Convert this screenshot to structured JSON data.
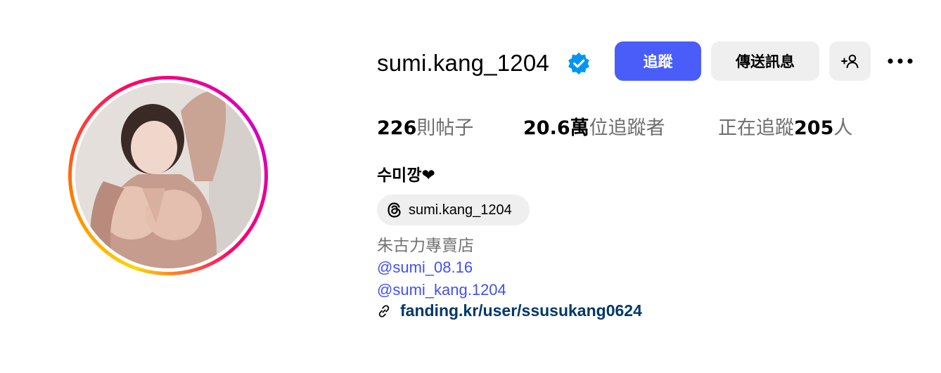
{
  "profile": {
    "username": "sumi.kang_1204",
    "full_name": "수미깡❤",
    "verified": true,
    "avatar_ring_colors": [
      "#ffd600",
      "#ff7a00",
      "#ff0169",
      "#d300c5"
    ]
  },
  "actions": {
    "follow_label": "追蹤",
    "message_label": "傳送訊息",
    "follow_color": "#4a5df9"
  },
  "stats": {
    "posts_count": "226",
    "posts_label": "則帖子",
    "followers_count": "20.6萬",
    "followers_label": "位追蹤者",
    "following_prefix": "正在追蹤",
    "following_count": "205",
    "following_suffix": "人"
  },
  "threads": {
    "handle": "sumi.kang_1204",
    "icon": "threads-icon"
  },
  "bio": {
    "category": "朱古力專賣店",
    "mentions": [
      "@sumi_08.16",
      "@sumi_kang.1204"
    ],
    "link": "fanding.kr/user/ssusukang0624",
    "link_color": "#00376b",
    "mention_color": "#4150f7"
  }
}
